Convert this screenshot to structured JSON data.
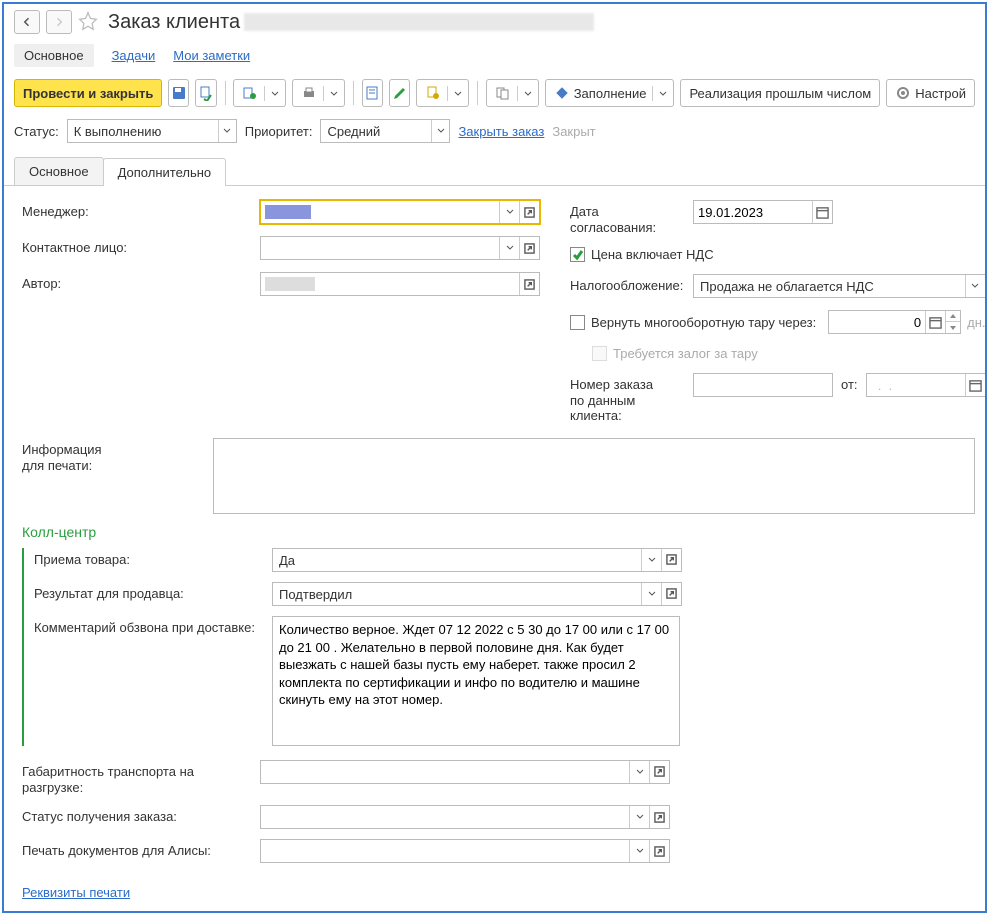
{
  "title": "Заказ клиента",
  "view_nav": {
    "main": "Основное",
    "tasks": "Задачи",
    "notes": "Мои заметки"
  },
  "toolbar": {
    "post_close": "Провести и закрыть",
    "fill": "Заполнение",
    "realization": "Реализация прошлым числом",
    "settings": "Настрой"
  },
  "status": {
    "label": "Статус:",
    "value": "К выполнению",
    "priority_label": "Приоритет:",
    "priority_value": "Средний",
    "close_order": "Закрыть заказ",
    "closed": "Закрыт"
  },
  "tabs": {
    "main": "Основное",
    "additional": "Дополнительно"
  },
  "left": {
    "manager": "Менеджер:",
    "contact": "Контактное лицо:",
    "author": "Автор:"
  },
  "right": {
    "agree_date_label": "Дата согласования:",
    "agree_date": "19.01.2023",
    "price_vat": "Цена включает НДС",
    "tax_label": "Налогообложение:",
    "tax_value": "Продажа не облагается НДС",
    "return_tara": "Вернуть многооборотную тару через:",
    "return_tara_val": "0",
    "days": "дн.",
    "deposit": "Требуется залог за тару",
    "client_order_label1": "Номер заказа",
    "client_order_label2": "по данным клиента:",
    "from": "от:",
    "from_date": "  .  .    "
  },
  "print_info_label1": "Информация",
  "print_info_label2": "для печати:",
  "call_center": {
    "title": "Колл-центр",
    "receive": "Приема товара:",
    "receive_val": "Да",
    "seller_result": "Результат для продавца:",
    "seller_result_val": "Подтвердил",
    "comment_label": "Комментарий обзвона при доставке:",
    "comment": "Количество верное. Ждет 07 12 2022 с 5 30 до 17 00 или с 17 00 до 21 00 . Желательно в первой половине дня. Как будет выезжать с нашей базы пусть ему наберет. также просил 2 комплекта по сертификации и инфо по водителю и машине скинуть ему на этот номер."
  },
  "lower": {
    "transport": "Габаритность транспорта на разгрузке:",
    "order_status": "Статус получения заказа:",
    "alice_docs": "Печать документов для Алисы:"
  },
  "print_requisites": "Реквизиты печати"
}
